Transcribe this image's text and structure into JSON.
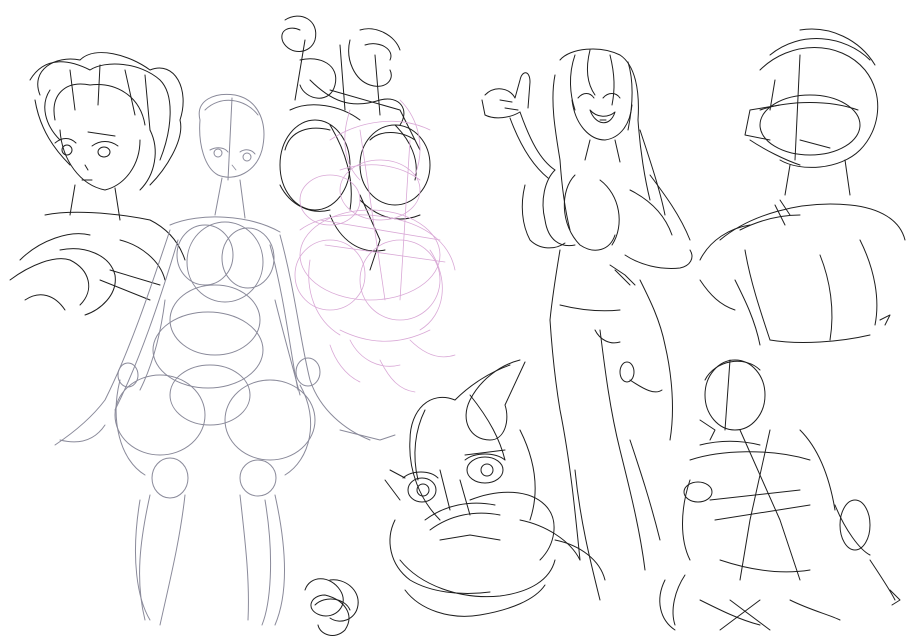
{
  "canvas": {
    "background": "#ffffff"
  },
  "colors": {
    "dark_ink": "#1e1e1e",
    "gray_ink": "#8a8a9a",
    "pink_ink": "#d9a8d6"
  },
  "sketches": [
    {
      "id": "girl-head-bob-hair",
      "ink": "dark"
    },
    {
      "id": "mannequin-figure-construction",
      "ink": "gray"
    },
    {
      "id": "tangled-scribble-figure",
      "ink": "dark"
    },
    {
      "id": "pink-construction-figure",
      "ink": "pink"
    },
    {
      "id": "girl-pointing-long-hair",
      "ink": "dark"
    },
    {
      "id": "bust-head-construction",
      "ink": "dark"
    },
    {
      "id": "cartoon-creature-face",
      "ink": "dark"
    },
    {
      "id": "small-crouching-figure",
      "ink": "dark"
    },
    {
      "id": "scribble-knot",
      "ink": "dark"
    }
  ]
}
